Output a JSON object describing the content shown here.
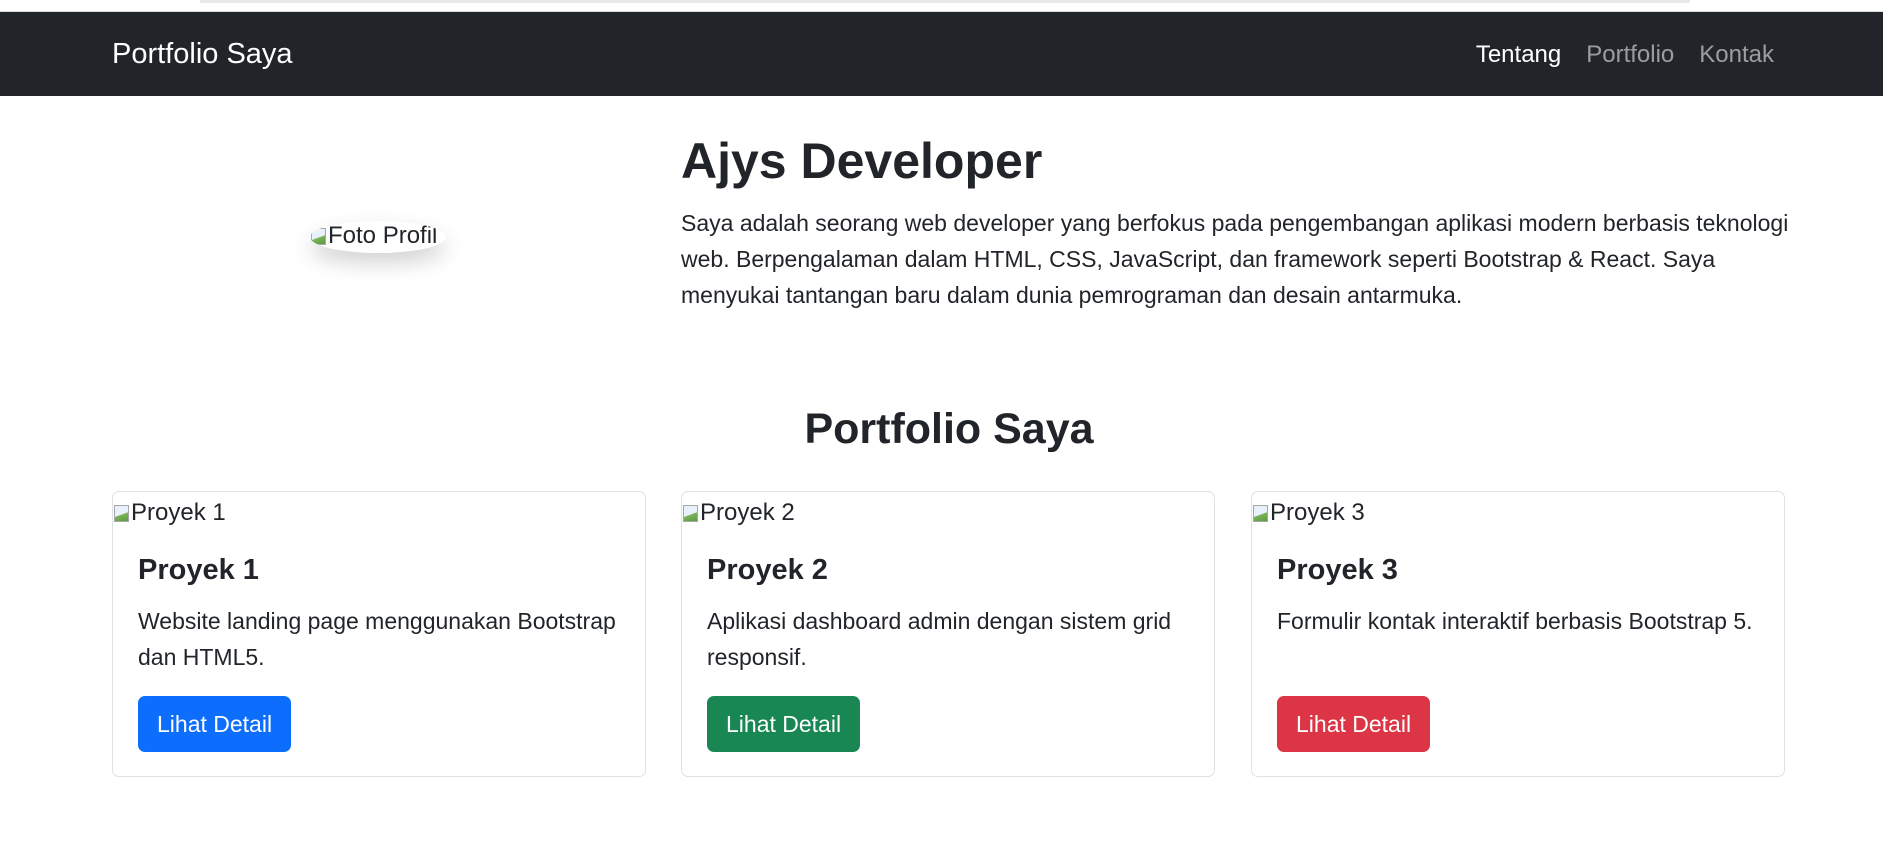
{
  "navbar": {
    "brand": "Portfolio Saya",
    "links": [
      {
        "label": "Tentang",
        "active": true
      },
      {
        "label": "Portfolio",
        "active": false
      },
      {
        "label": "Kontak",
        "active": false
      }
    ]
  },
  "hero": {
    "profile_alt": "Foto Profil",
    "name": "Ajys Developer",
    "description": "Saya adalah seorang web developer yang berfokus pada pengembangan aplikasi modern berbasis teknologi web. Berpengalaman dalam HTML, CSS, JavaScript, dan framework seperti Bootstrap & React. Saya menyukai tantangan baru dalam dunia pemrograman dan desain antarmuka."
  },
  "portfolio": {
    "title": "Portfolio Saya",
    "cards": [
      {
        "img_alt": "Proyek 1",
        "title": "Proyek 1",
        "text": "Website landing page menggunakan Bootstrap dan HTML5.",
        "button": "Lihat Detail",
        "button_color": "#0d6efd"
      },
      {
        "img_alt": "Proyek 2",
        "title": "Proyek 2",
        "text": "Aplikasi dashboard admin dengan sistem grid responsif.",
        "button": "Lihat Detail",
        "button_color": "#198754"
      },
      {
        "img_alt": "Proyek 3",
        "title": "Proyek 3",
        "text": "Formulir kontak interaktif berbasis Bootstrap 5.",
        "button": "Lihat Detail",
        "button_color": "#dc3545"
      }
    ]
  },
  "colors": {
    "navbar_bg": "#212529",
    "nav_active": "#ffffff",
    "nav_inactive": "rgba(255,255,255,0.55)"
  }
}
